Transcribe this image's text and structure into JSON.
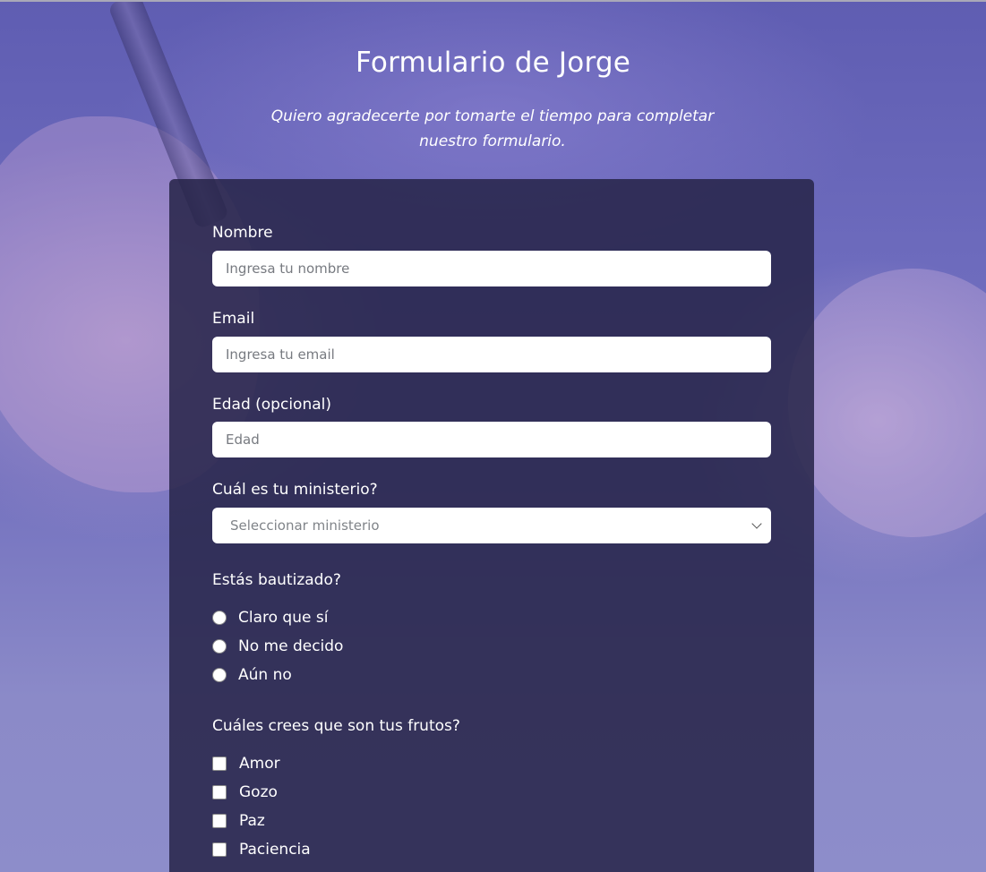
{
  "header": {
    "title": "Formulario de Jorge",
    "subtitle": "Quiero agradecerte por tomarte el tiempo para completar nuestro formulario."
  },
  "form": {
    "name": {
      "label": "Nombre",
      "placeholder": "Ingresa tu nombre"
    },
    "email": {
      "label": "Email",
      "placeholder": "Ingresa tu email"
    },
    "age": {
      "label": "Edad (opcional)",
      "placeholder": "Edad"
    },
    "ministry": {
      "label": "Cuál es tu ministerio?",
      "selected": "Seleccionar ministerio"
    },
    "baptized": {
      "label": "Estás bautizado?",
      "options": [
        "Claro que sí",
        "No me decido",
        "Aún no"
      ]
    },
    "fruits": {
      "label": "Cuáles crees que son tus frutos?",
      "options": [
        "Amor",
        "Gozo",
        "Paz",
        "Paciencia"
      ]
    }
  }
}
